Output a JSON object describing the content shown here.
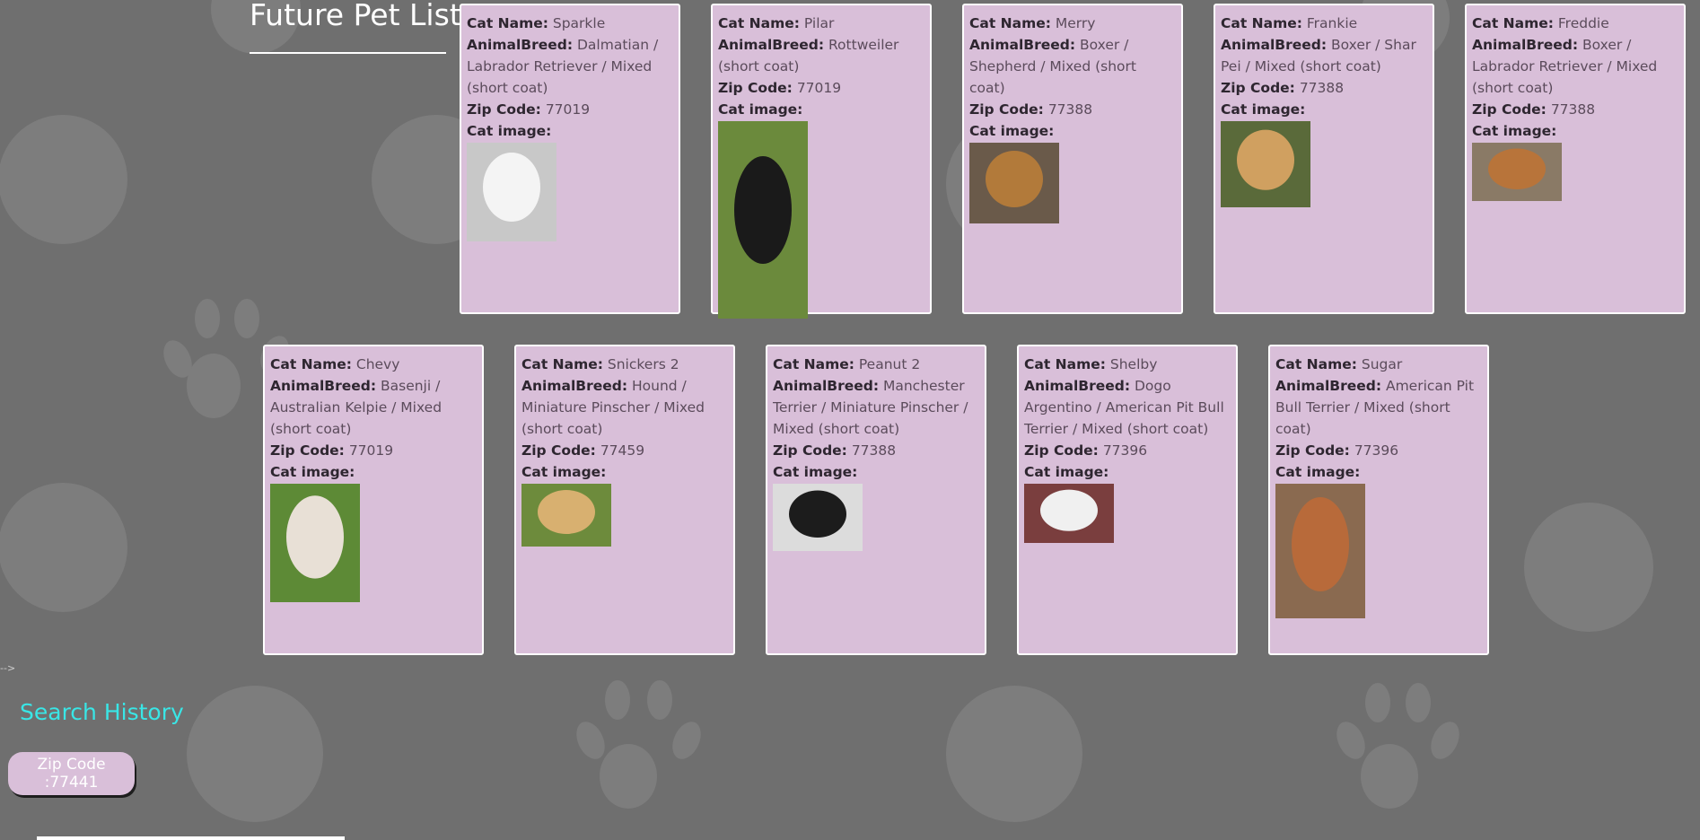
{
  "header": {
    "title": "Future Pet List"
  },
  "field_labels": {
    "name": "Cat Name:",
    "breed": "AnimalBreed:",
    "zip": "Zip Code:",
    "image": "Cat image:"
  },
  "pets": [
    {
      "name": "Sparkle",
      "breed": "Dalmatian / Labrador Retriever / Mixed (short coat)",
      "zip": "77019"
    },
    {
      "name": "Pilar",
      "breed": "Rottweiler (short coat)",
      "zip": "77019"
    },
    {
      "name": "Merry",
      "breed": "Boxer / Shepherd / Mixed (short coat)",
      "zip": "77388"
    },
    {
      "name": "Frankie",
      "breed": "Boxer / Shar Pei / Mixed (short coat)",
      "zip": "77388"
    },
    {
      "name": "Freddie",
      "breed": "Boxer / Labrador Retriever / Mixed (short coat)",
      "zip": "77388"
    },
    {
      "name": "Chevy",
      "breed": "Basenji / Australian Kelpie / Mixed (short coat)",
      "zip": "77019"
    },
    {
      "name": "Snickers 2",
      "breed": "Hound / Miniature Pinscher / Mixed (short coat)",
      "zip": "77459"
    },
    {
      "name": "Peanut 2",
      "breed": "Manchester Terrier / Miniature Pinscher / Mixed (short coat)",
      "zip": "77388"
    },
    {
      "name": "Shelby",
      "breed": "Dogo Argentino / American Pit Bull Terrier / Mixed (short coat)",
      "zip": "77396"
    },
    {
      "name": "Sugar",
      "breed": "American Pit Bull Terrier / Mixed (short coat)",
      "zip": "77396"
    }
  ],
  "stray_text": "-->",
  "search_history": {
    "title": "Search History",
    "items": [
      "Zip Code :77441"
    ]
  },
  "colors": {
    "background": "#6f6f6f",
    "card": "#d9bfd9",
    "history_title": "#39e6e6"
  }
}
